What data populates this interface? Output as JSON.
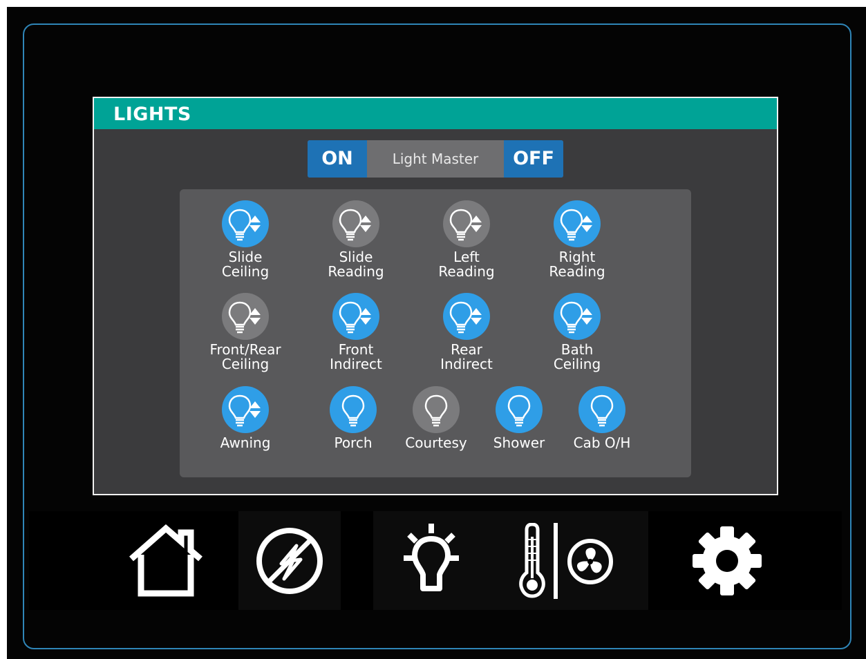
{
  "panel": {
    "title": "LIGHTS"
  },
  "master": {
    "on_label": "ON",
    "label": "Light Master",
    "off_label": "OFF"
  },
  "lights": [
    {
      "line1": "Slide",
      "line2": "Ceiling",
      "state": "on",
      "dimmable": true
    },
    {
      "line1": "Slide",
      "line2": "Reading",
      "state": "off",
      "dimmable": true
    },
    {
      "line1": "Left",
      "line2": "Reading",
      "state": "off",
      "dimmable": true
    },
    {
      "line1": "Right",
      "line2": "Reading",
      "state": "on",
      "dimmable": true
    },
    {
      "line1": "Front/Rear",
      "line2": "Ceiling",
      "state": "off",
      "dimmable": true
    },
    {
      "line1": "Front",
      "line2": "Indirect",
      "state": "on",
      "dimmable": true
    },
    {
      "line1": "Rear",
      "line2": "Indirect",
      "state": "on",
      "dimmable": true
    },
    {
      "line1": "Bath",
      "line2": "Ceiling",
      "state": "on",
      "dimmable": true
    },
    {
      "line1": "Awning",
      "line2": "",
      "state": "on",
      "dimmable": true
    },
    {
      "line1": "Porch",
      "line2": "",
      "state": "on",
      "dimmable": false
    },
    {
      "line1": "Courtesy",
      "line2": "",
      "state": "off",
      "dimmable": false
    },
    {
      "line1": "Shower",
      "line2": "",
      "state": "on",
      "dimmable": false
    },
    {
      "line1": "Cab O/H",
      "line2": "",
      "state": "on",
      "dimmable": false
    }
  ],
  "nav": [
    {
      "icon": "home-icon"
    },
    {
      "icon": "power-icon"
    },
    {
      "icon": "lightbulb-icon",
      "active": true
    },
    {
      "icon": "thermostat-fan-icon"
    },
    {
      "icon": "gear-icon"
    }
  ],
  "colors": {
    "accent_header": "#00a396",
    "light_on": "#2f9ee7",
    "light_off": "#7b7b7d",
    "master_buttons": "#1e72b5",
    "bezel": "#2f86b8"
  }
}
